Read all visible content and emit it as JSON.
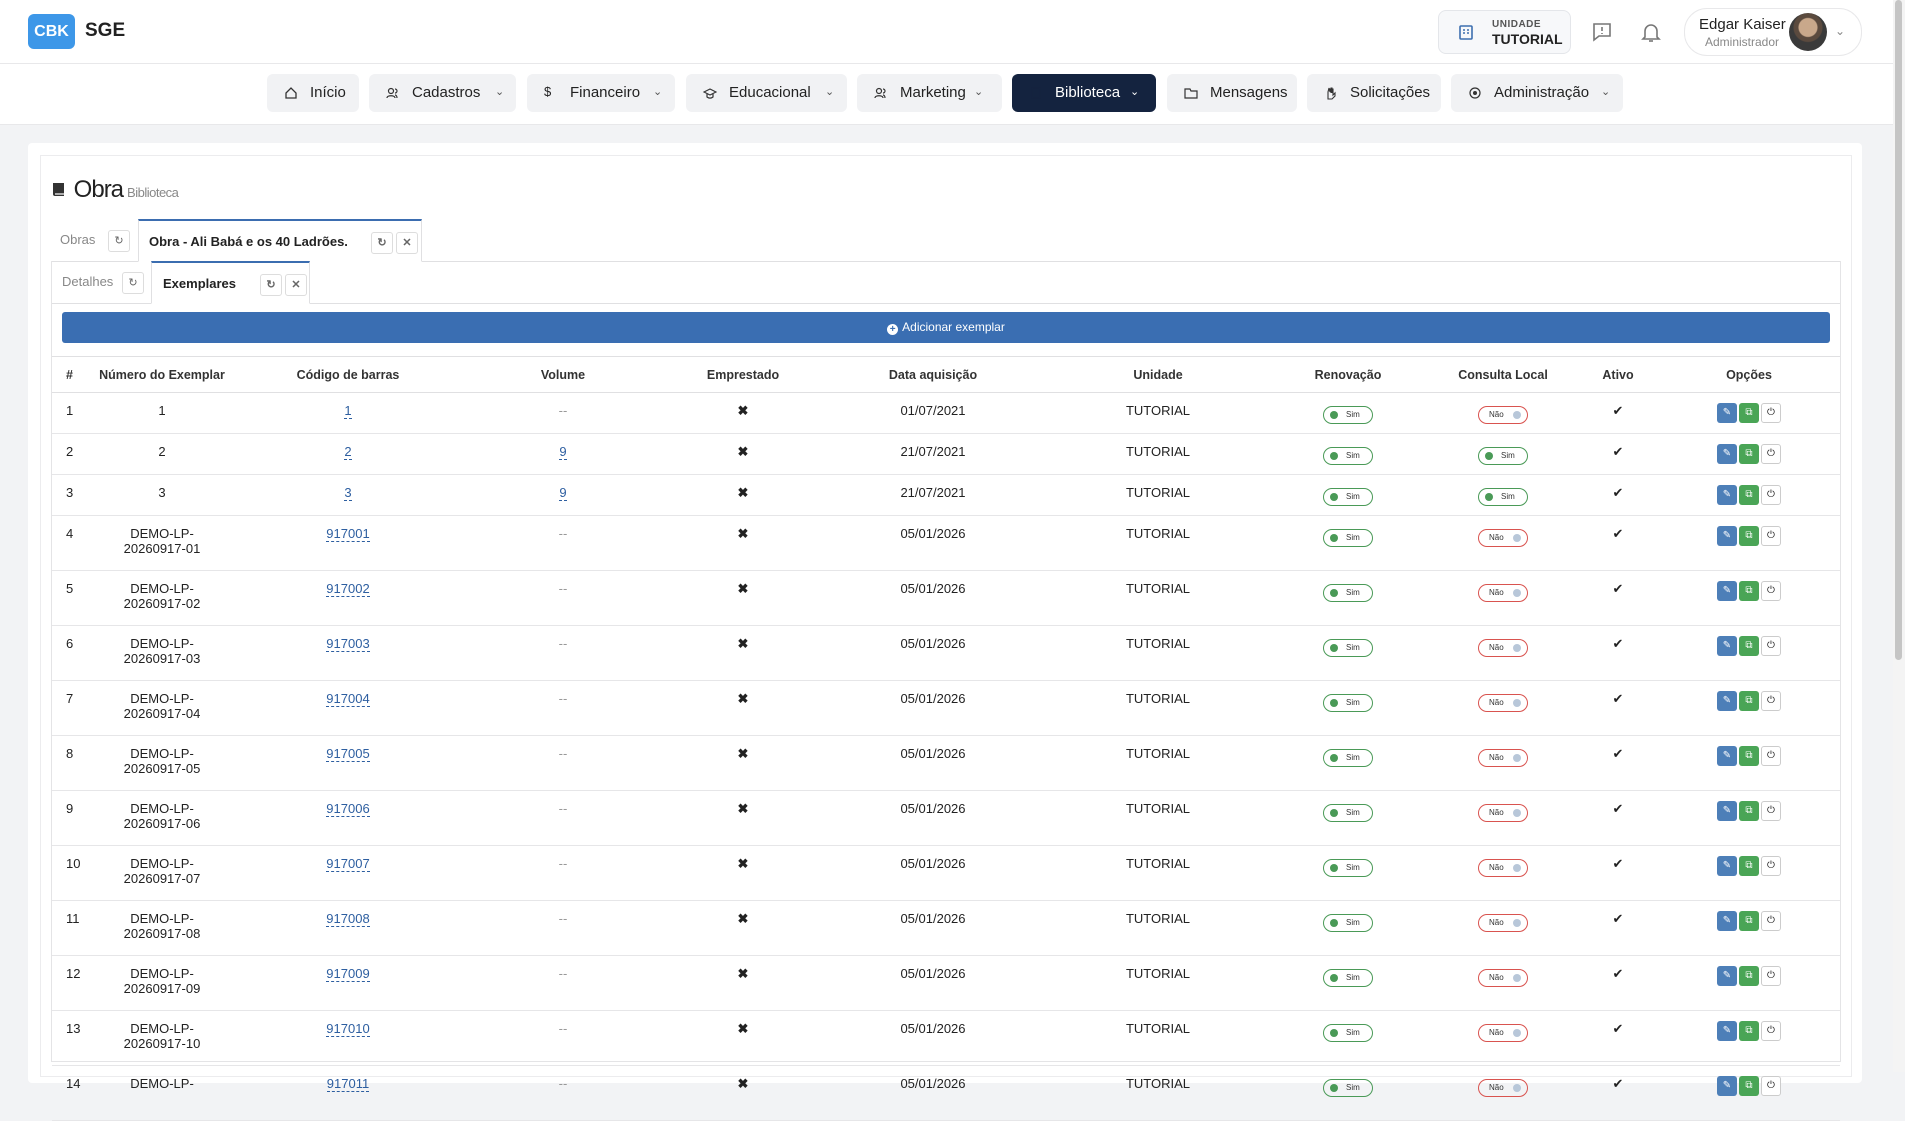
{
  "app": {
    "logo": "CBK",
    "name": "SGE"
  },
  "header": {
    "unit_label": "UNIDADE",
    "unit_value": "TUTORIAL",
    "user_name": "Edgar Kaiser",
    "user_role": "Administrador"
  },
  "nav": [
    {
      "label": "Início",
      "icon": "home-icon",
      "dropdown": false,
      "active": false
    },
    {
      "label": "Cadastros",
      "icon": "users-icon",
      "dropdown": true,
      "active": false
    },
    {
      "label": "Financeiro",
      "icon": "dollar-icon",
      "dropdown": true,
      "active": false
    },
    {
      "label": "Educacional",
      "icon": "graduation-cap-icon",
      "dropdown": true,
      "active": false
    },
    {
      "label": "Marketing",
      "icon": "users-icon",
      "dropdown": true,
      "active": false
    },
    {
      "label": "Biblioteca",
      "icon": "book-icon",
      "dropdown": true,
      "active": true
    },
    {
      "label": "Mensagens",
      "icon": "folder-icon",
      "dropdown": false,
      "active": false
    },
    {
      "label": "Solicitações",
      "icon": "hand-icon",
      "dropdown": false,
      "active": false
    },
    {
      "label": "Administração",
      "icon": "cog-icon",
      "dropdown": true,
      "active": false
    }
  ],
  "page": {
    "title": "Obra",
    "subtitle": "Biblioteca",
    "tabs": [
      {
        "label": "Obras"
      },
      {
        "label": "Obra - Ali Babá e os 40 Ladrões."
      }
    ],
    "subtabs": [
      {
        "label": "Detalhes"
      },
      {
        "label": "Exemplares"
      }
    ],
    "add_button": "Adicionar exemplar"
  },
  "table": {
    "columns": [
      "#",
      "Número do Exemplar",
      "Código de barras",
      "Volume",
      "Emprestado",
      "Data aquisição",
      "Unidade",
      "Renovação",
      "Consulta Local",
      "Ativo",
      "Opções"
    ],
    "rows": [
      {
        "idx": "1",
        "numero": [
          "1"
        ],
        "codigo": "1",
        "volume": "--",
        "emprestado": "✖",
        "data": "01/07/2021",
        "unidade": "TUTORIAL",
        "renovacao": "Sim",
        "consulta": "Não",
        "ativo": "✔"
      },
      {
        "idx": "2",
        "numero": [
          "2"
        ],
        "codigo": "2",
        "volume": "9",
        "emprestado": "✖",
        "data": "21/07/2021",
        "unidade": "TUTORIAL",
        "renovacao": "Sim",
        "consulta": "Sim",
        "ativo": "✔"
      },
      {
        "idx": "3",
        "numero": [
          "3"
        ],
        "codigo": "3",
        "volume": "9",
        "emprestado": "✖",
        "data": "21/07/2021",
        "unidade": "TUTORIAL",
        "renovacao": "Sim",
        "consulta": "Sim",
        "ativo": "✔"
      },
      {
        "idx": "4",
        "numero": [
          "DEMO-LP-",
          "20260917-01"
        ],
        "codigo": "917001",
        "volume": "--",
        "emprestado": "✖",
        "data": "05/01/2026",
        "unidade": "TUTORIAL",
        "renovacao": "Sim",
        "consulta": "Não",
        "ativo": "✔"
      },
      {
        "idx": "5",
        "numero": [
          "DEMO-LP-",
          "20260917-02"
        ],
        "codigo": "917002",
        "volume": "--",
        "emprestado": "✖",
        "data": "05/01/2026",
        "unidade": "TUTORIAL",
        "renovacao": "Sim",
        "consulta": "Não",
        "ativo": "✔"
      },
      {
        "idx": "6",
        "numero": [
          "DEMO-LP-",
          "20260917-03"
        ],
        "codigo": "917003",
        "volume": "--",
        "emprestado": "✖",
        "data": "05/01/2026",
        "unidade": "TUTORIAL",
        "renovacao": "Sim",
        "consulta": "Não",
        "ativo": "✔"
      },
      {
        "idx": "7",
        "numero": [
          "DEMO-LP-",
          "20260917-04"
        ],
        "codigo": "917004",
        "volume": "--",
        "emprestado": "✖",
        "data": "05/01/2026",
        "unidade": "TUTORIAL",
        "renovacao": "Sim",
        "consulta": "Não",
        "ativo": "✔"
      },
      {
        "idx": "8",
        "numero": [
          "DEMO-LP-",
          "20260917-05"
        ],
        "codigo": "917005",
        "volume": "--",
        "emprestado": "✖",
        "data": "05/01/2026",
        "unidade": "TUTORIAL",
        "renovacao": "Sim",
        "consulta": "Não",
        "ativo": "✔"
      },
      {
        "idx": "9",
        "numero": [
          "DEMO-LP-",
          "20260917-06"
        ],
        "codigo": "917006",
        "volume": "--",
        "emprestado": "✖",
        "data": "05/01/2026",
        "unidade": "TUTORIAL",
        "renovacao": "Sim",
        "consulta": "Não",
        "ativo": "✔"
      },
      {
        "idx": "10",
        "numero": [
          "DEMO-LP-",
          "20260917-07"
        ],
        "codigo": "917007",
        "volume": "--",
        "emprestado": "✖",
        "data": "05/01/2026",
        "unidade": "TUTORIAL",
        "renovacao": "Sim",
        "consulta": "Não",
        "ativo": "✔"
      },
      {
        "idx": "11",
        "numero": [
          "DEMO-LP-",
          "20260917-08"
        ],
        "codigo": "917008",
        "volume": "--",
        "emprestado": "✖",
        "data": "05/01/2026",
        "unidade": "TUTORIAL",
        "renovacao": "Sim",
        "consulta": "Não",
        "ativo": "✔"
      },
      {
        "idx": "12",
        "numero": [
          "DEMO-LP-",
          "20260917-09"
        ],
        "codigo": "917009",
        "volume": "--",
        "emprestado": "✖",
        "data": "05/01/2026",
        "unidade": "TUTORIAL",
        "renovacao": "Sim",
        "consulta": "Não",
        "ativo": "✔"
      },
      {
        "idx": "13",
        "numero": [
          "DEMO-LP-",
          "20260917-10"
        ],
        "codigo": "917010",
        "volume": "--",
        "emprestado": "✖",
        "data": "05/01/2026",
        "unidade": "TUTORIAL",
        "renovacao": "Sim",
        "consulta": "Não",
        "ativo": "✔"
      },
      {
        "idx": "14",
        "numero": [
          "DEMO-LP-",
          ""
        ],
        "codigo": "917011",
        "volume": "--",
        "emprestado": "✖",
        "data": "05/01/2026",
        "unidade": "TUTORIAL",
        "renovacao": "Sim",
        "consulta": "Não",
        "ativo": "✔"
      }
    ]
  },
  "colors": {
    "brand": "#3d97e8",
    "nav_active": "#14233f",
    "primary_button": "#3a6eb2",
    "toggle_on": "#4a9a57",
    "toggle_off": "#d9534f",
    "edit_button": "#4d7fb8",
    "copy_button": "#4aa556"
  }
}
